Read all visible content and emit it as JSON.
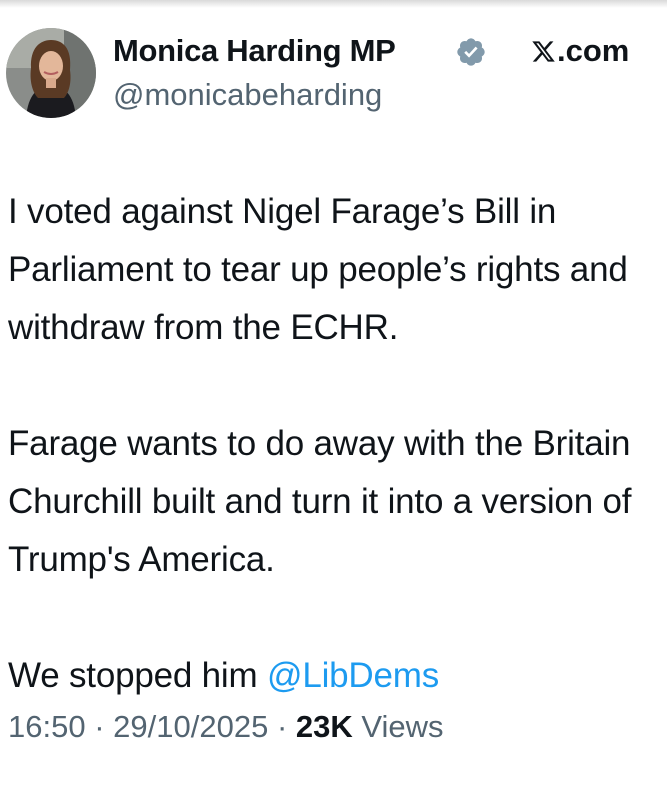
{
  "author": {
    "display_name": "Monica Harding MP",
    "handle": "@monicabeharding",
    "verified": true
  },
  "brand": {
    "label": ".com",
    "logo_icon": "x-logo-icon"
  },
  "tweet": {
    "paragraph_1": "I voted against Nigel Farage’s Bill in Parliament to tear up people’s rights and withdraw from the ECHR.",
    "paragraph_2": "Farage wants to do away with the Britain Churchill built and turn it into a version of Trump's America.",
    "paragraph_3_text": "We stopped him ",
    "paragraph_3_mention": "@LibDems"
  },
  "meta": {
    "time": "16:50",
    "separator": "·",
    "date": "29/10/2025",
    "views_count": "23K",
    "views_label": "Views"
  },
  "colors": {
    "text": "#0f1419",
    "secondary": "#536471",
    "link": "#1d9bf0",
    "verified_badge": "#829aab"
  }
}
